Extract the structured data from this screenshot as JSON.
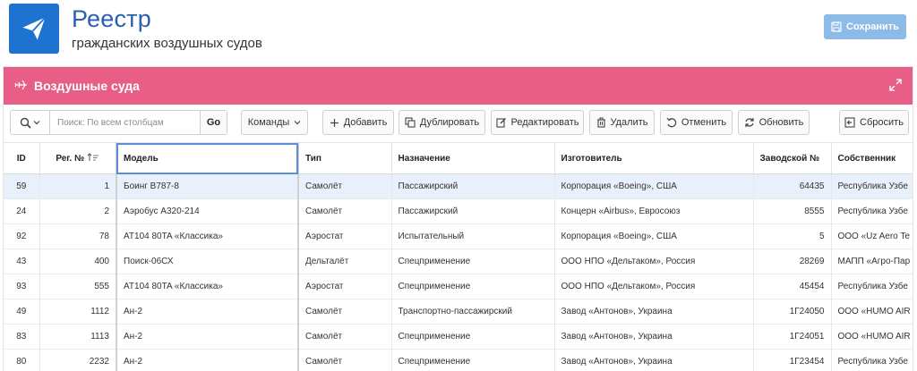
{
  "header": {
    "title": "Реестр",
    "subtitle": "гражданских воздушных судов",
    "save_label": "Сохранить"
  },
  "region": {
    "title": "Воздушные суда"
  },
  "toolbar": {
    "search_placeholder": "Поиск: По всем столбцам",
    "go_label": "Go",
    "commands_label": "Команды",
    "add_label": "Добавить",
    "duplicate_label": "Дублировать",
    "edit_label": "Редактировать",
    "delete_label": "Удалить",
    "cancel_label": "Отменить",
    "refresh_label": "Обновить",
    "reset_label": "Сбросить"
  },
  "grid": {
    "columns": [
      "ID",
      "Рег. №",
      "Модель",
      "Тип",
      "Назначение",
      "Изготовитель",
      "Заводской №",
      "Собственник"
    ],
    "rows": [
      [
        "59",
        "1",
        "Боинг B787-8",
        "Самолёт",
        "Пассажирский",
        "Корпорация «Boeing», США",
        "64435",
        "Республика Узбе"
      ],
      [
        "24",
        "2",
        "Аэробус А320-214",
        "Самолёт",
        "Пассажирский",
        "Концерн «Airbus», Евросоюз",
        "8555",
        "Республика Узбе"
      ],
      [
        "92",
        "78",
        "AT104 80TA «Классика»",
        "Аэростат",
        "Испытательный",
        "Корпорация «Boeing», США",
        "5",
        "ООО «Uz Aero Te"
      ],
      [
        "43",
        "400",
        "Поиск-06СХ",
        "Дельталёт",
        "Спецприменение",
        "ООО НПО «Дельтаком», Россия",
        "28269",
        "МАПП «Агро-Пар"
      ],
      [
        "93",
        "555",
        "AT104 80TA «Классика»",
        "Аэростат",
        "Спецприменение",
        "ООО НПО «Дельтаком», Россия",
        "45454",
        "Республика Узбе"
      ],
      [
        "49",
        "1112",
        "Ан-2",
        "Самолёт",
        "Транспортно-пассажирский",
        "Завод «Антонов», Украина",
        "1Г24050",
        "ООО «HUMO AIR"
      ],
      [
        "83",
        "1113",
        "Ан-2",
        "Самолёт",
        "Спецприменение",
        "Завод «Антонов», Украина",
        "1Г24051",
        "ООО «HUMO AIR"
      ],
      [
        "80",
        "2232",
        "Ан-2",
        "Самолёт",
        "Спецприменение",
        "Завод «Антонов», Украина",
        "1Г23454",
        "Республика Узбе"
      ]
    ]
  },
  "colors": {
    "brand": "#1f73d0",
    "region_header": "#e85e86",
    "save_button": "#8cbbe8",
    "selected_row": "#e8f0fb"
  }
}
